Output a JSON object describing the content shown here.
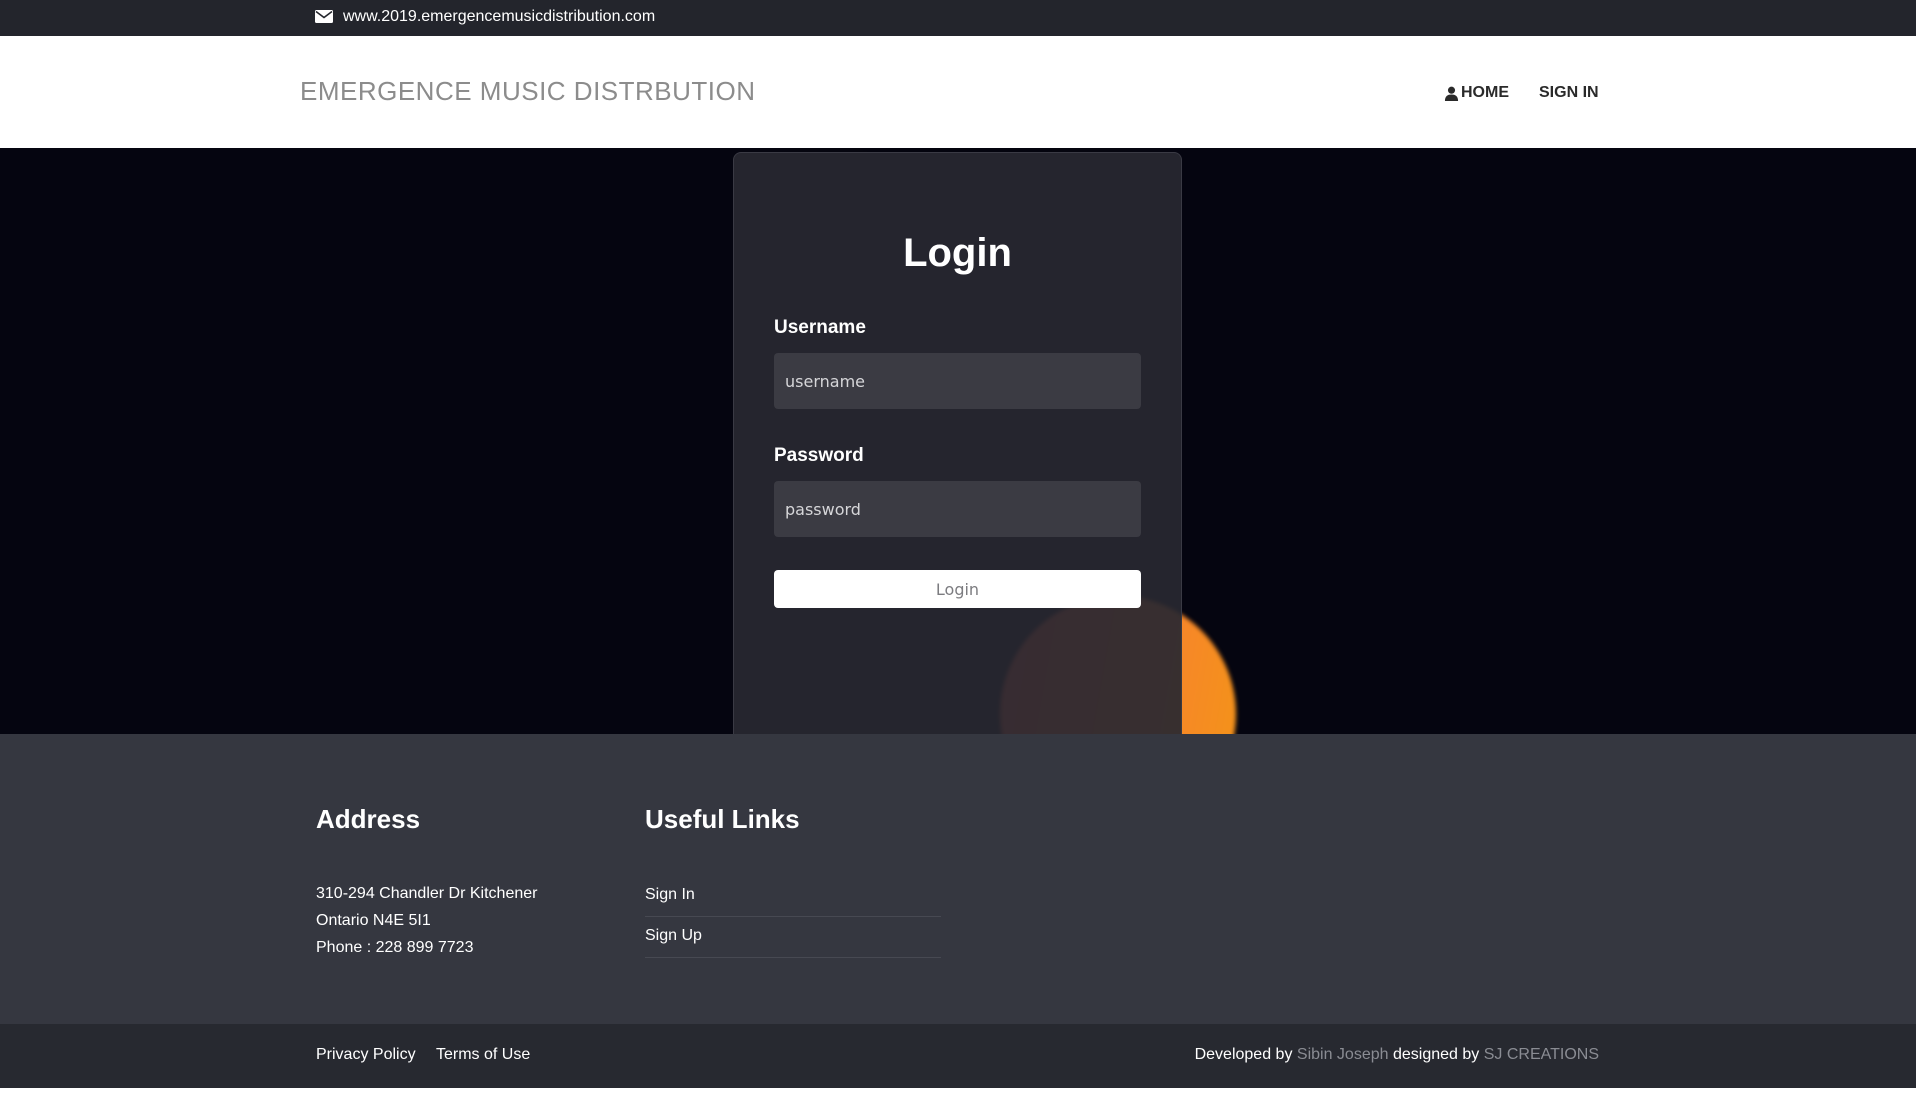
{
  "topbar": {
    "icon": "envelope-icon",
    "url": "www.2019.emergencemusicdistribution.com"
  },
  "navbar": {
    "brand": "EMERGENCE MUSIC DISTRBUTION",
    "home": "HOME",
    "home_icon": "user-icon",
    "signin": "SIGN IN"
  },
  "login": {
    "title": "Login",
    "username_label": "Username",
    "username_placeholder": "username",
    "password_label": "Password",
    "password_placeholder": "password",
    "button": "Login"
  },
  "footer": {
    "address_title": "Address",
    "address_line1": "310-294 Chandler Dr Kitchener",
    "address_line2": "Ontario N4E 5I1",
    "phone": "Phone : 228 899 7723",
    "links_title": "Useful Links",
    "links": [
      "Sign In",
      "Sign Up"
    ]
  },
  "bottombar": {
    "privacy": "Privacy Policy",
    "terms": "Terms of Use",
    "developed_by": "Developed by",
    "developer": "Sibin Joseph",
    "designed_by": "designed by",
    "designer": "SJ CREATIONS"
  },
  "colors": {
    "orb_start": "#ff5d4a",
    "orb_end": "#f39417",
    "background": "#050510"
  }
}
